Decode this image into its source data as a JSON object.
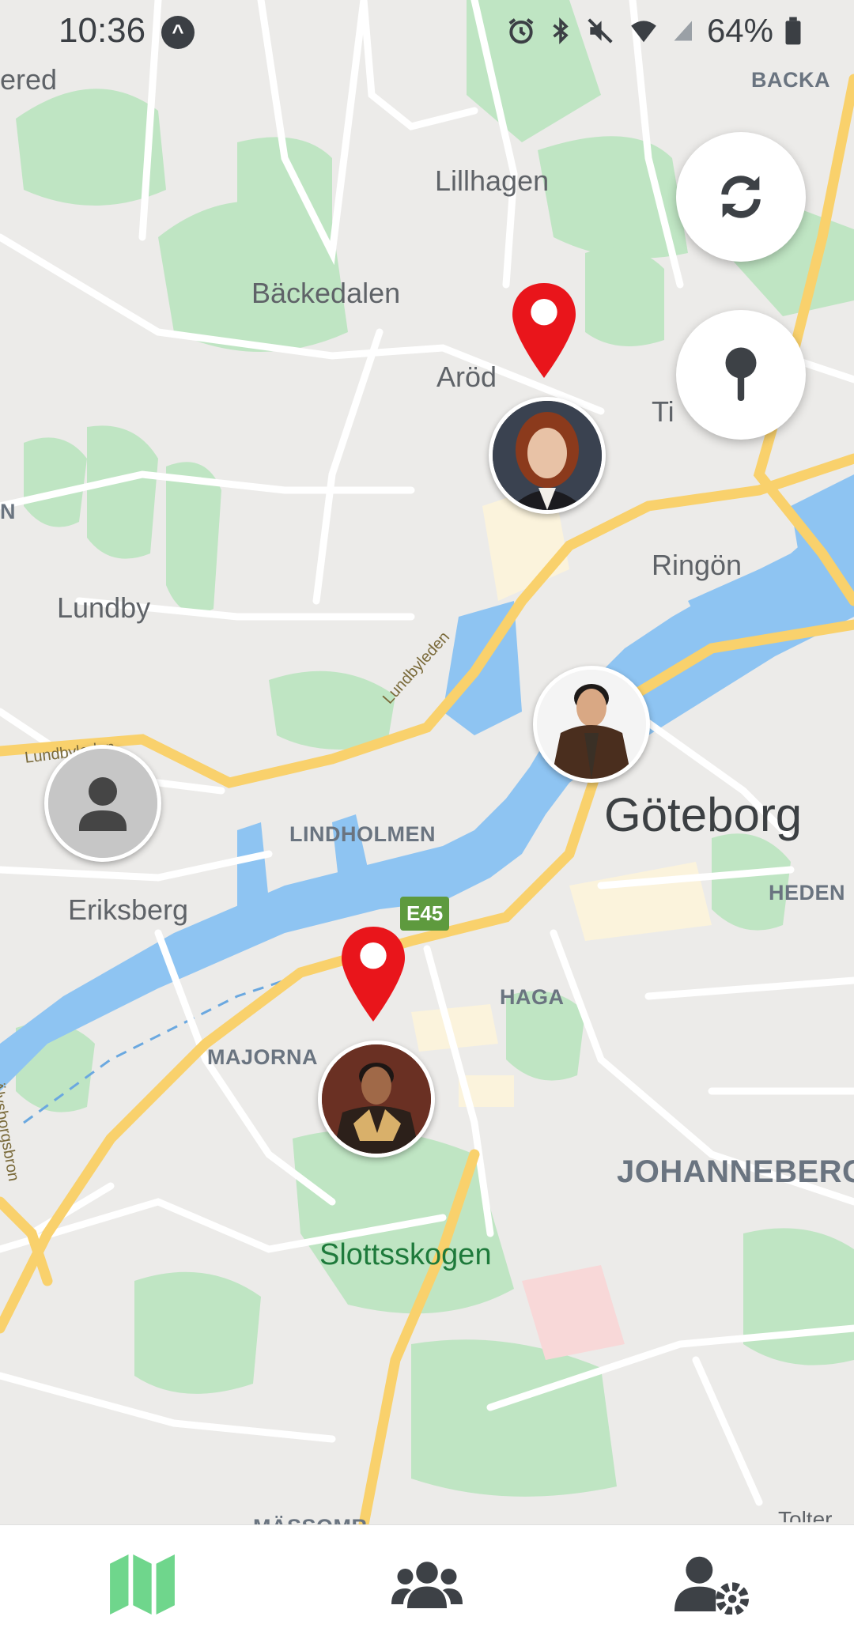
{
  "status_bar": {
    "time": "10:36",
    "battery": "64%",
    "icons": [
      "navigation-arrow-icon",
      "alarm-icon",
      "bluetooth-icon",
      "mute-icon",
      "wifi-icon",
      "signal-icon",
      "battery-icon"
    ]
  },
  "map": {
    "labels": {
      "backa": "BACKA",
      "lillhagen": "Lillhagen",
      "backedalen": "Bäckedalen",
      "arod": "Aröd",
      "tingstad": "Ti",
      "ered": "ered",
      "lundby": "Lundby",
      "ringon": "Ringön",
      "goteborg": "Göteborg",
      "lindholmen": "LINDHOLMEN",
      "heden": "HEDEN",
      "eriksberg": "Eriksberg",
      "haga": "HAGA",
      "majorna": "MAJORNA",
      "johanneberg": "JOHANNEBERG",
      "slottsskogen": "Slottsskogen",
      "lundbyleden": "Lundbyleden",
      "lundbyleden_left": "Lundbyleden",
      "e45": "E45",
      "n_edge": "N",
      "alvsborgsbron": "Älvsborgsbron",
      "masthugget_cut": "MÄSSOMR",
      "tolter": "Tolter"
    },
    "accent_colors": {
      "water": "#8ec4f2",
      "park": "#bfe5c3",
      "highway": "#f9d16c",
      "pin": "#e9151b"
    }
  },
  "buttons": {
    "refresh_icon": "refresh-icon",
    "pin_icon": "pushpin-icon"
  },
  "friends": [
    {
      "name": "friend-1"
    },
    {
      "name": "friend-2"
    },
    {
      "name": "friend-3"
    },
    {
      "name": "current-user"
    }
  ],
  "bottom_nav": {
    "tabs": [
      {
        "icon": "map-icon",
        "active": true,
        "color": "#6fd68c"
      },
      {
        "icon": "users-icon",
        "active": false,
        "color": "#3d4146"
      },
      {
        "icon": "user-settings-icon",
        "active": false,
        "color": "#3d4146"
      }
    ]
  }
}
